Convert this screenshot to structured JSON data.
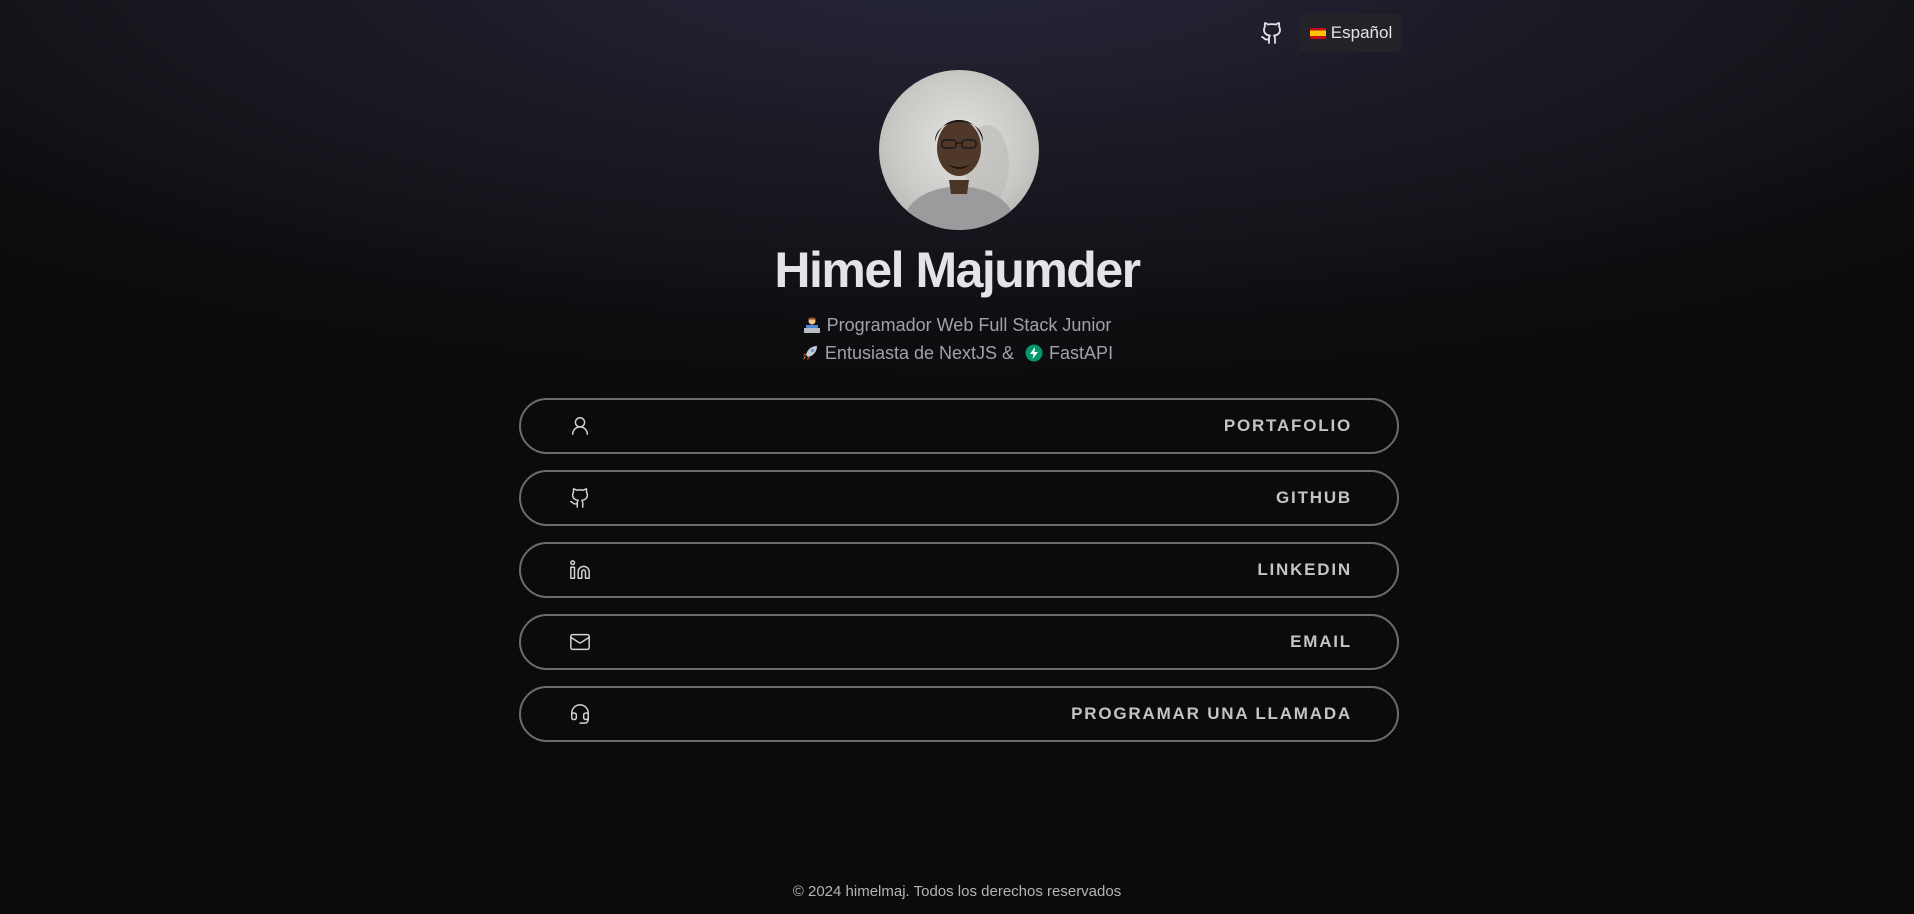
{
  "header": {
    "github_icon": "github-icon",
    "language": {
      "flag_icon": "spain-flag-icon",
      "label": "Español"
    }
  },
  "profile": {
    "avatar": "profile-photo",
    "name": "Himel Majumder",
    "tagline_1": {
      "emoji": "technologist-emoji",
      "text": "Programador Web Full Stack Junior"
    },
    "tagline_2": {
      "emoji_1": "rocket-emoji",
      "text_1": "Entusiasta de NextJS &",
      "emoji_2": "fastapi-logo",
      "text_2": "FastAPI"
    }
  },
  "links": [
    {
      "icon": "user-icon",
      "label": "PORTAFOLIO"
    },
    {
      "icon": "github-icon",
      "label": "GITHUB"
    },
    {
      "icon": "linkedin-icon",
      "label": "LINKEDIN"
    },
    {
      "icon": "mail-icon",
      "label": "EMAIL"
    },
    {
      "icon": "headset-icon",
      "label": "PROGRAMAR UNA LLAMADA"
    }
  ],
  "footer": {
    "text": "© 2024 himelmaj. Todos los derechos reservados"
  },
  "colors": {
    "background": "#0b0b0b",
    "top_glow": "#25253a",
    "text_primary": "#e4e4e7",
    "text_muted": "#a1a1aa",
    "button_border": "#6b6b72",
    "fastapi_green": "#059669"
  }
}
